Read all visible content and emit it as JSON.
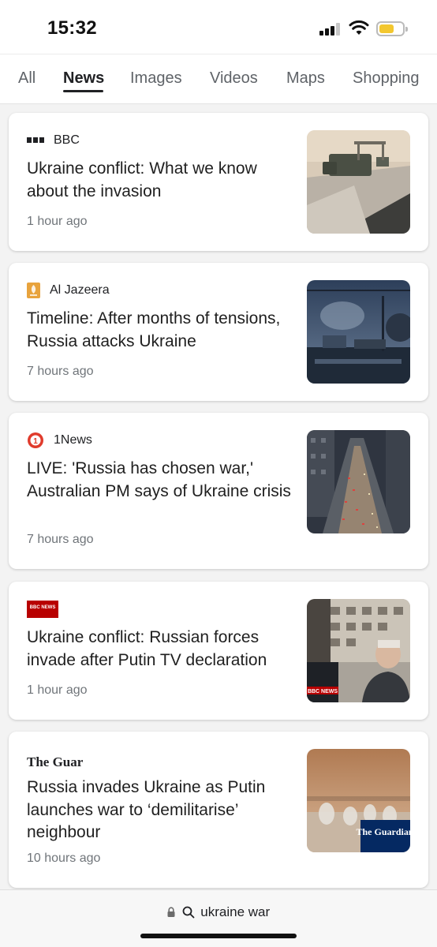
{
  "status": {
    "time": "15:32"
  },
  "tabs": [
    {
      "label": "All"
    },
    {
      "label": "News"
    },
    {
      "label": "Images"
    },
    {
      "label": "Videos"
    },
    {
      "label": "Maps"
    },
    {
      "label": "Shopping"
    }
  ],
  "active_tab": "News",
  "articles": [
    {
      "source": "BBC",
      "title": "Ukraine conflict: What we know about the invasion",
      "time": "1 hour ago",
      "icon": "bbc-dots-icon"
    },
    {
      "source": "Al Jazeera",
      "title": "Timeline: After months of tensions, Russia attacks Ukraine",
      "time": "7 hours ago",
      "icon": "al-jazeera-logo-icon"
    },
    {
      "source": "1News",
      "title": "LIVE: 'Russia has chosen war,' Australian PM says of Ukraine crisis",
      "time": "7 hours ago",
      "icon": "1news-logo-icon"
    },
    {
      "source_logo_text": "BBC NEWS",
      "title": "Ukraine conflict: Russian forces invade after Putin TV declaration",
      "time": "1 hour ago",
      "icon": "bbc-news-logo-icon",
      "thumb_overlay": "BBC NEWS"
    },
    {
      "source_logo_text": "The Guardian",
      "title": "Russia invades Ukraine as Putin launches war to ‘demilitarise’ neighbour",
      "time": "10 hours ago",
      "icon": "guardian-logo-icon",
      "thumb_overlay": "The Guardian"
    }
  ],
  "address_bar": {
    "query": "ukraine war"
  },
  "colors": {
    "battery": "#f3c72f",
    "bbc_red": "#b80000",
    "guardian_navy": "#052962",
    "al_jazeera_orange": "#e8a33d",
    "onenews_red": "#e03b2c"
  }
}
